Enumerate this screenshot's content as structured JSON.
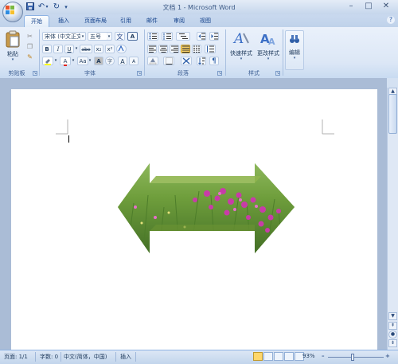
{
  "window": {
    "title": "文档 1 - Microsoft Word",
    "min_icon": "minimize-icon",
    "max_icon": "maximize-icon",
    "close_icon": "close-icon",
    "min_glyph": "–",
    "max_glyph": "□",
    "close_glyph": "✕"
  },
  "qat": {
    "customize_glyph": "▾"
  },
  "tabs": [
    "开始",
    "插入",
    "页面布局",
    "引用",
    "邮件",
    "审阅",
    "视图"
  ],
  "ribbon": {
    "clipboard": {
      "paste_label": "粘贴",
      "group_label": "剪贴板"
    },
    "font": {
      "font_name": "宋体 (中文正文)",
      "font_size": "五号",
      "group_label": "字体",
      "bold": "B",
      "italic": "I",
      "underline": "U",
      "strike": "abe",
      "subscript": "x₂",
      "superscript": "x²",
      "grow": "A",
      "shrink": "A",
      "case": "Aa",
      "clear": "A",
      "char_shade": "A",
      "enclose": "字",
      "phonetic": "文"
    },
    "paragraph": {
      "group_label": "段落"
    },
    "styles": {
      "quick_styles_label": "快速样式",
      "change_styles_label": "更改样式",
      "group_label": "样式"
    },
    "editing": {
      "label": "编辑"
    }
  },
  "document": {
    "image_description_icon": "double-arrow-flower-picture"
  },
  "status": {
    "page": "页面: 1/1",
    "words": "字数: 0",
    "language": "中文(简体，中国)",
    "mode": "插入",
    "zoom": "93%",
    "zoom_out": "–",
    "zoom_in": "+"
  },
  "colors": {
    "accent": "#15428b",
    "arrow_bevel": "#7fa73f",
    "flower": "#c83ca8"
  }
}
